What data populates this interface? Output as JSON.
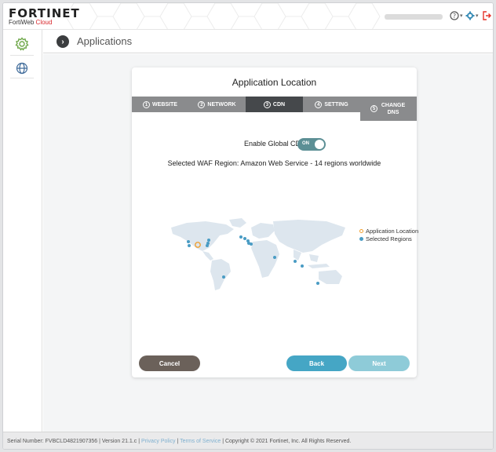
{
  "brand": {
    "logo_text": "FORTINET",
    "product_prefix": "FortiWeb",
    "product_suffix": "Cloud"
  },
  "header": {
    "help_icon": "question-circle-icon",
    "settings_icon": "gear-icon",
    "logout_icon": "logout-icon"
  },
  "sidebar": {
    "items": [
      {
        "icon": "gear-icon",
        "active": true
      },
      {
        "icon": "globe-icon",
        "active": false
      }
    ]
  },
  "breadcrumb": {
    "title": "Applications"
  },
  "wizard": {
    "title": "Application Location",
    "steps": [
      {
        "num": "1",
        "label": "WEBSITE"
      },
      {
        "num": "2",
        "label": "NETWORK"
      },
      {
        "num": "3",
        "label": "CDN"
      },
      {
        "num": "4",
        "label": "SETTING"
      },
      {
        "num": "5",
        "label": "CHANGE DNS"
      }
    ],
    "active_step": 2,
    "cdn_label": "Enable Global CDN:",
    "cdn_toggle_text": "ON",
    "cdn_enabled": true,
    "region_text": "Selected WAF Region: Amazon Web Service - 14 regions worldwide",
    "legend": {
      "app_location": "Application Location",
      "selected_regions": "Selected Regions"
    },
    "buttons": {
      "cancel": "Cancel",
      "back": "Back",
      "next": "Next"
    }
  },
  "footer": {
    "serial": "Serial Number: FVBCLD4821907356 | Version 21.1.c | ",
    "privacy": "Privacy Policy",
    "sep": " | ",
    "terms": "Terms of Service",
    "copyright": " | Copyright © 2021 Fortinet, Inc. All Rights Reserved."
  },
  "colors": {
    "app_location": "#f0a030",
    "selected_region": "#4a9cc4",
    "step_active": "#45484b",
    "step_inactive": "#8a8b8d",
    "toggle_on": "#5c8f95"
  }
}
